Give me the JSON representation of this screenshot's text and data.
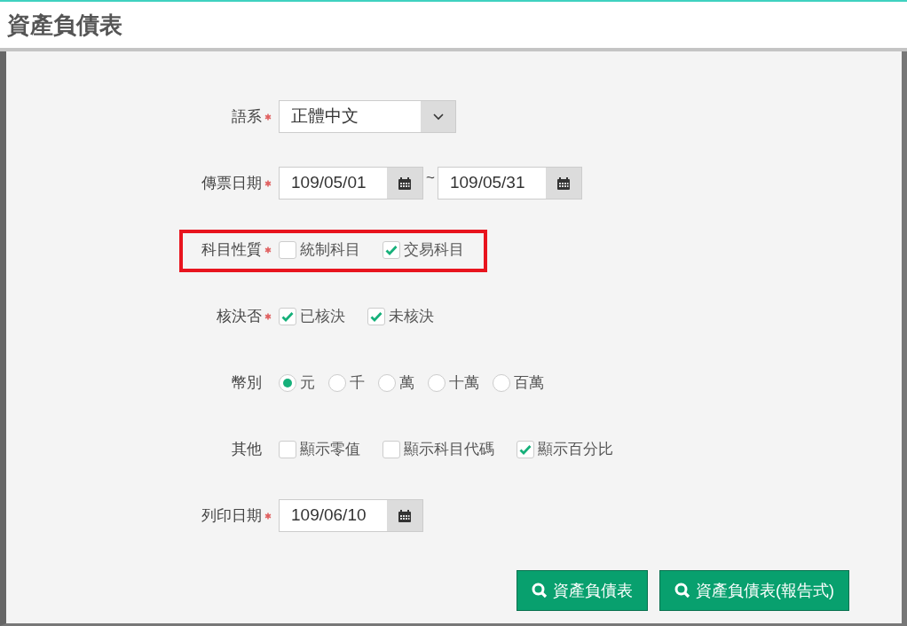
{
  "title": "資產負債表",
  "fields": [
    {
      "kind": "select",
      "label": "語系",
      "required": true,
      "highlighted": false,
      "value": "正體中文"
    },
    {
      "kind": "date_range",
      "label": "傳票日期",
      "required": true,
      "highlighted": false,
      "from": "109/05/01",
      "separator": "~",
      "to": "109/05/31"
    },
    {
      "kind": "checkboxes",
      "label": "科目性質",
      "required": true,
      "highlighted": true,
      "options": [
        {
          "label": "統制科目",
          "checked": false
        },
        {
          "label": "交易科目",
          "checked": true
        }
      ]
    },
    {
      "kind": "checkboxes",
      "label": "核決否",
      "required": true,
      "highlighted": false,
      "options": [
        {
          "label": "已核決",
          "checked": true
        },
        {
          "label": "未核決",
          "checked": true
        }
      ]
    },
    {
      "kind": "radios",
      "label": "幣別",
      "required": false,
      "highlighted": false,
      "options": [
        {
          "label": "元",
          "selected": true
        },
        {
          "label": "千",
          "selected": false
        },
        {
          "label": "萬",
          "selected": false
        },
        {
          "label": "十萬",
          "selected": false
        },
        {
          "label": "百萬",
          "selected": false
        }
      ]
    },
    {
      "kind": "checkboxes",
      "label": "其他",
      "required": false,
      "highlighted": false,
      "options": [
        {
          "label": "顯示零值",
          "checked": false
        },
        {
          "label": "顯示科目代碼",
          "checked": false
        },
        {
          "label": "顯示百分比",
          "checked": true
        }
      ]
    },
    {
      "kind": "date",
      "label": "列印日期",
      "required": true,
      "highlighted": false,
      "value": "109/06/10"
    }
  ],
  "buttons": [
    "資產負債表",
    "資產負債表(報告式)"
  ]
}
